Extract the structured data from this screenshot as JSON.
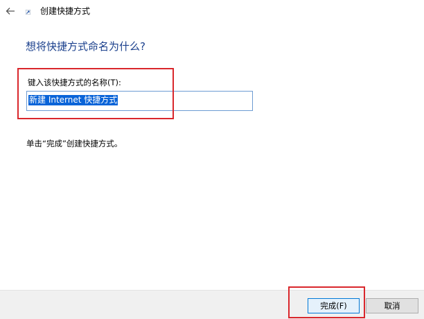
{
  "window": {
    "title": "创建快捷方式"
  },
  "main": {
    "heading": "想将快捷方式命名为什么?",
    "field_label": "键入该快捷方式的名称(T):",
    "field_value": "新建 Internet 快捷方式",
    "hint": "单击“完成”创建快捷方式。"
  },
  "footer": {
    "finish_label": "完成(F)",
    "cancel_label": "取消"
  },
  "colors": {
    "heading": "#1a3f8c",
    "selection": "#0a64d8",
    "annotation": "#d9262b",
    "accent_border": "#0078d7"
  }
}
